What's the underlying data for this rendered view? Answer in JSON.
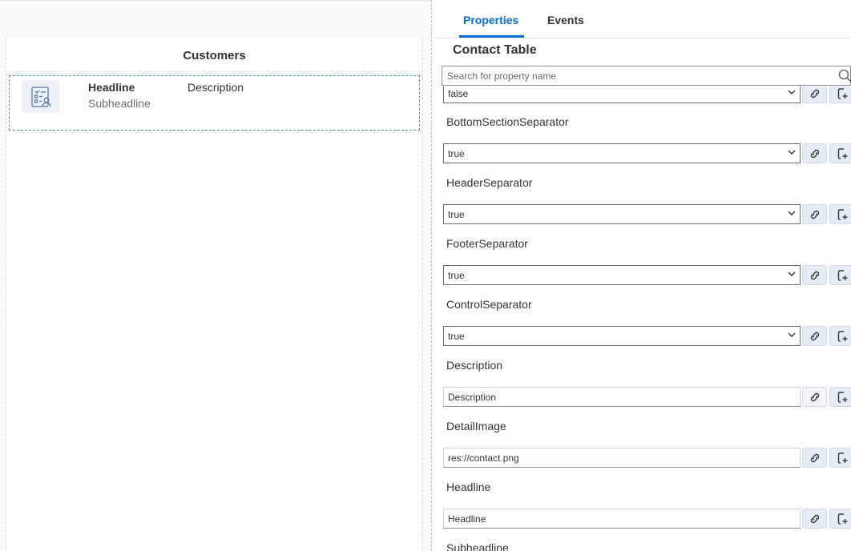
{
  "canvas": {
    "section_title": "Customers",
    "cell": {
      "headline": "Headline",
      "subheadline": "Subheadline",
      "description": "Description",
      "icon": "contact-card-icon"
    }
  },
  "panel": {
    "tabs": [
      {
        "label": "Properties",
        "active": true
      },
      {
        "label": "Events",
        "active": false
      }
    ],
    "title": "Contact Table",
    "search": {
      "placeholder": "Search for property name",
      "icon": "search-icon"
    },
    "first_value": "false",
    "properties": [
      {
        "label": "BottomSectionSeparator",
        "type": "select",
        "value": "true"
      },
      {
        "label": "HeaderSeparator",
        "type": "select",
        "value": "true"
      },
      {
        "label": "FooterSeparator",
        "type": "select",
        "value": "true"
      },
      {
        "label": "ControlSeparator",
        "type": "select",
        "value": "true"
      },
      {
        "label": "Description",
        "type": "input",
        "value": "Description"
      },
      {
        "label": "DetailImage",
        "type": "input",
        "value": "res://contact.png"
      },
      {
        "label": "Headline",
        "type": "input",
        "value": "Headline"
      },
      {
        "label": "Subheadline",
        "type": "input",
        "value": ""
      }
    ]
  },
  "colors": {
    "accent": "#0a6ed1",
    "text": "#32363a",
    "button_bg": "#e5ecf3"
  }
}
